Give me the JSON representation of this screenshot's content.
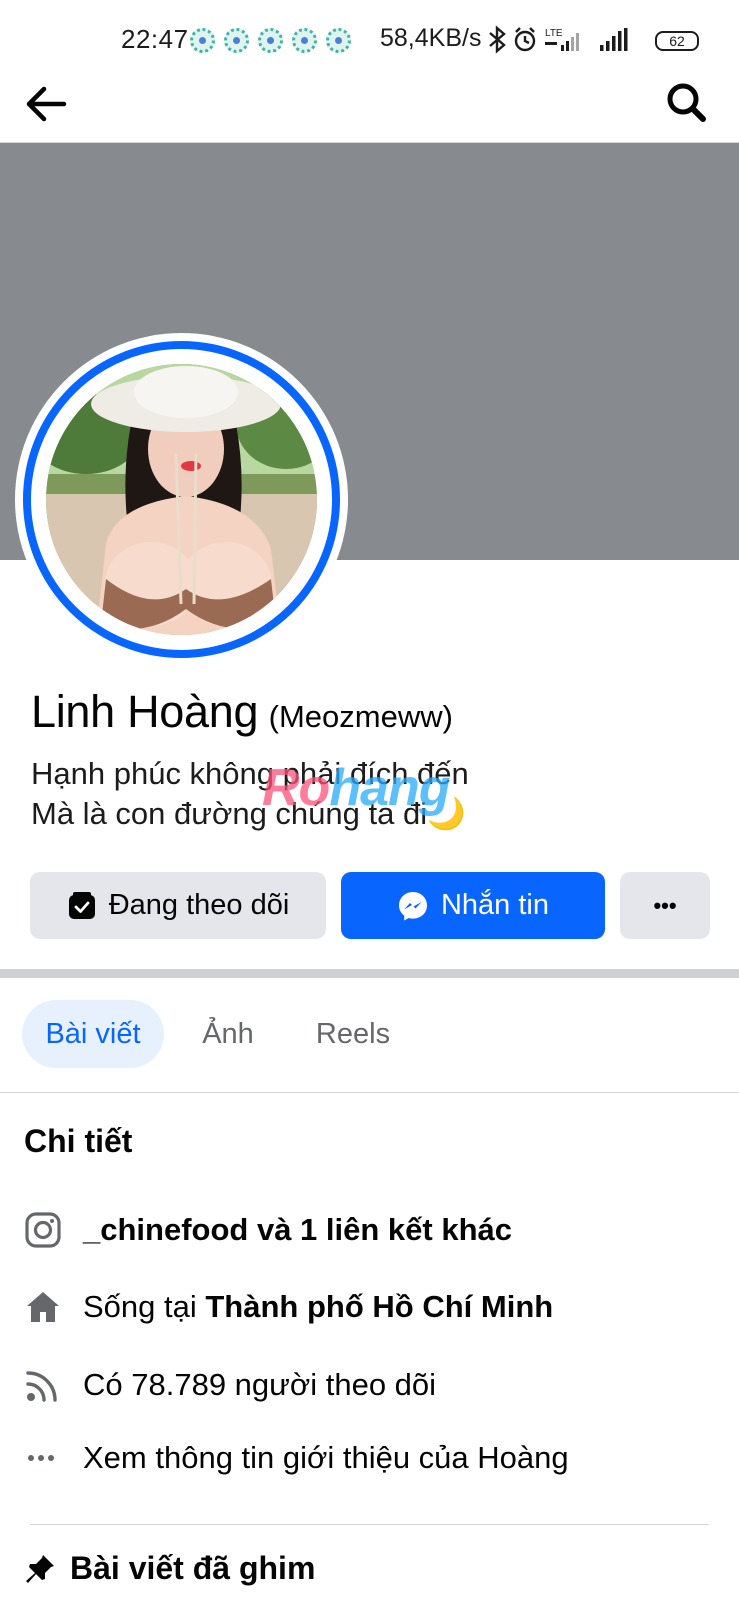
{
  "status_bar": {
    "time": "22:47",
    "network_speed": "58,4KB/s",
    "network_type": "LTE",
    "battery": "62"
  },
  "nav": {
    "back_icon": "arrow-left-icon",
    "search_icon": "search-icon"
  },
  "profile": {
    "name": "Linh Hoàng",
    "alternate_name": "(Meozmeww)",
    "bio_line1": "Hạnh phúc không phải đích đến",
    "bio_line2": "Mà là con đường chúng ta đi🌙",
    "watermark_part1": "Ro",
    "watermark_part2": "hang"
  },
  "actions": {
    "following_label": "Đang theo dõi",
    "message_label": "Nhắn tin",
    "more_label": "•••"
  },
  "tabs": [
    {
      "label": "Bài viết",
      "active": true
    },
    {
      "label": "Ảnh",
      "active": false
    },
    {
      "label": "Reels",
      "active": false
    }
  ],
  "details": {
    "title": "Chi tiết",
    "instagram_handle": "_chinefood",
    "instagram_suffix": " và 1 liên kết khác",
    "lives_prefix": "Sống tại ",
    "lives_city": "Thành phố Hồ Chí Minh",
    "followers_text": "Có 78.789 người theo dõi",
    "about_text": "Xem thông tin giới thiệu của Hoàng"
  },
  "pinned": {
    "label": "Bài viết đã ghim"
  },
  "colors": {
    "brand_blue": "#0866ff",
    "cover_gray": "#878a8e",
    "button_gray": "#e4e6eb",
    "active_tab_bg": "#e7f0fd"
  }
}
